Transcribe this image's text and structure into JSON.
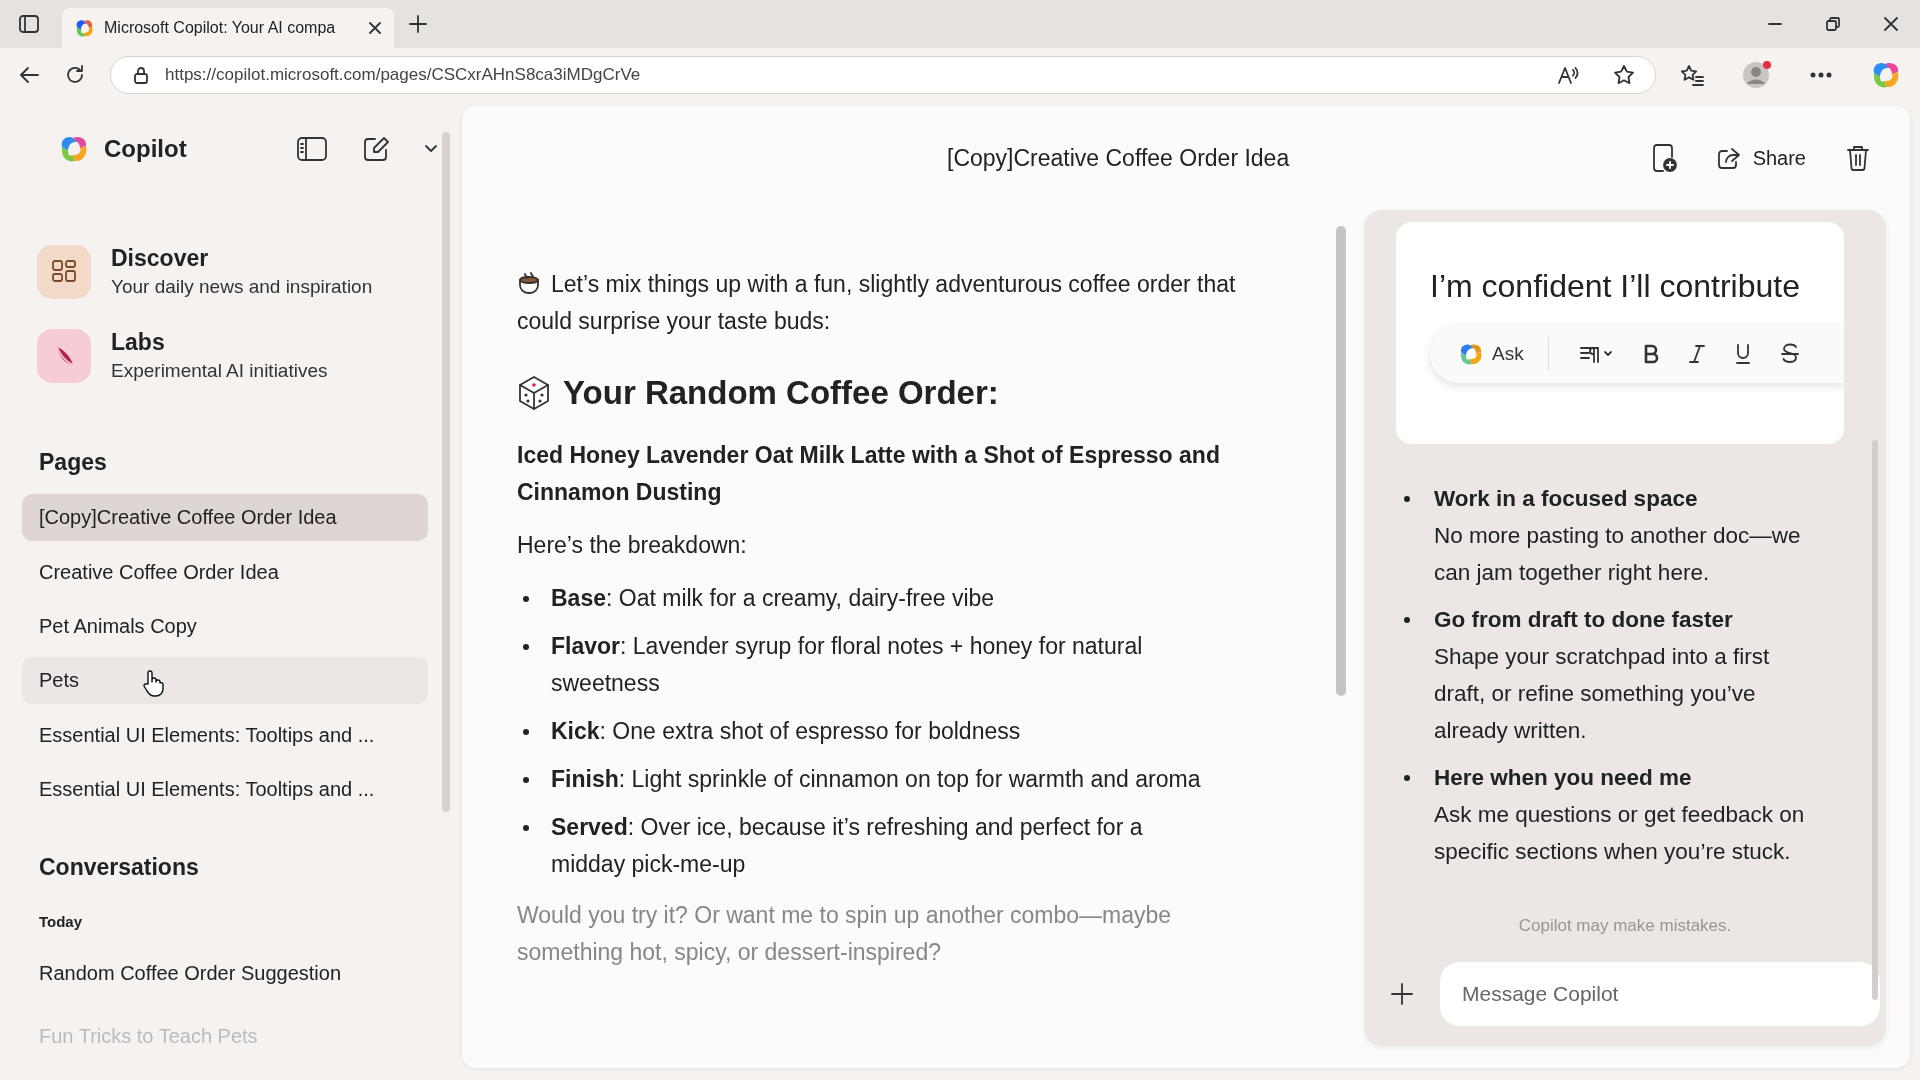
{
  "browser": {
    "tab_title": "Microsoft Copilot: Your AI compa",
    "url": "https://copilot.microsoft.com/pages/CSCxrAHnS8ca3iMDgCrVe"
  },
  "sidebar": {
    "brand": "Copilot",
    "features": [
      {
        "kind": "discover",
        "title": "Discover",
        "subtitle": "Your daily news and inspiration"
      },
      {
        "kind": "labs",
        "title": "Labs",
        "subtitle": "Experimental AI initiatives"
      }
    ],
    "pages_heading": "Pages",
    "pages": [
      {
        "label": "[Copy]Creative Coffee Order Idea",
        "selected": true,
        "hovered": false
      },
      {
        "label": "Creative Coffee Order Idea",
        "selected": false,
        "hovered": false
      },
      {
        "label": "Pet Animals Copy",
        "selected": false,
        "hovered": false
      },
      {
        "label": "Pets",
        "selected": false,
        "hovered": true
      },
      {
        "label": "Essential UI Elements: Tooltips and ...",
        "selected": false,
        "hovered": false
      },
      {
        "label": "Essential UI Elements: Tooltips and ...",
        "selected": false,
        "hovered": false
      }
    ],
    "conversations_heading": "Conversations",
    "conversation_groups": [
      {
        "label": "Today",
        "items": [
          "Random Coffee Order Suggestion",
          "Fun Tricks to Teach Pets"
        ]
      }
    ]
  },
  "document": {
    "title": "[Copy]Creative Coffee Order Idea",
    "share_label": "Share",
    "intro": "Let’s mix things up with a fun, slightly adventurous coffee order that could surprise your taste buds:",
    "heading": "Your Random Coffee Order:",
    "order_name": "Iced Honey Lavender Oat Milk Latte with a Shot of Espresso and Cinnamon Dusting",
    "breakdown_intro": "Here’s the breakdown:",
    "bullets": [
      "**Base**: Oat milk for a creamy, dairy-free vibe",
      "**Flavor**: Lavender syrup for floral notes + honey for natural sweetness",
      "**Kick**: One extra shot of espresso for boldness",
      "**Finish**: Light sprinkle of cinnamon on top for warmth and aroma",
      "**Served**: Over ice, because it’s refreshing and perfect for a midday pick-me-up"
    ],
    "closing": "Would you try it? Or want me to spin up another combo—maybe something hot, spicy, or dessert-inspired?"
  },
  "assistant": {
    "draft": "I’m confident I’ll contribute",
    "ask_label": "Ask",
    "features": [
      {
        "title": "Work in a focused space",
        "description": "No more pasting to another doc—we can jam together right here."
      },
      {
        "title": "Go from draft to done faster",
        "description": "Shape your scratchpad into a first draft, or refine something you’ve already written."
      },
      {
        "title": "Here when you need me",
        "description": "Ask me questions or get feedback on specific sections when you’re stuck."
      }
    ],
    "disclaimer": "Copilot may make mistakes.",
    "message_placeholder": "Message Copilot"
  }
}
